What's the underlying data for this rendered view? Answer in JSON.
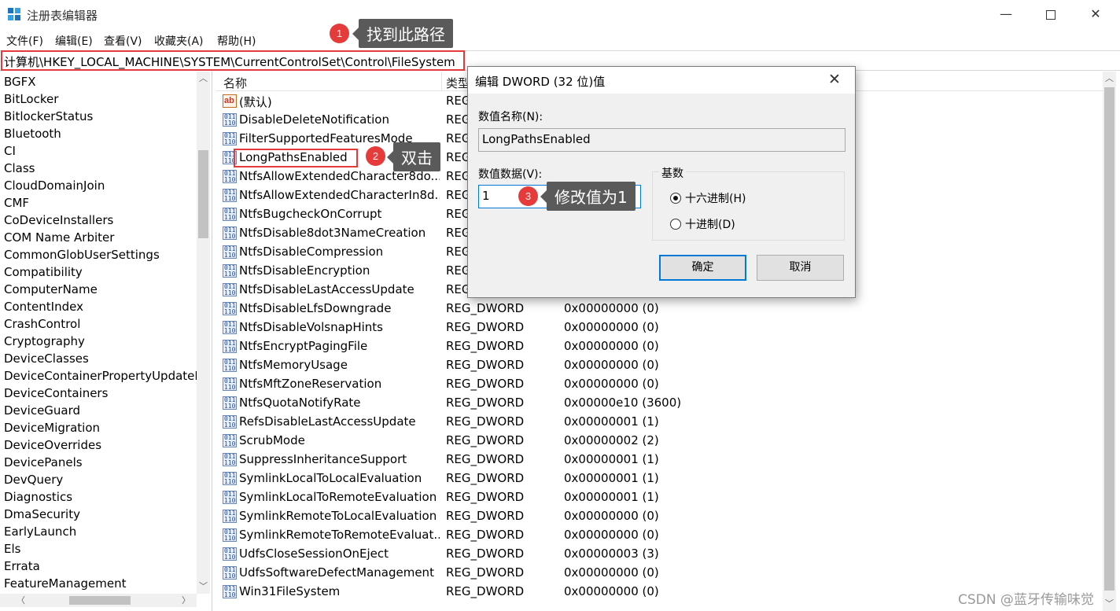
{
  "window": {
    "title": "注册表编辑器",
    "minimize_glyph": "—",
    "close_glyph": "✕"
  },
  "menu": [
    "文件(F)",
    "编辑(E)",
    "查看(V)",
    "收藏夹(A)",
    "帮助(H)"
  ],
  "address": "计算机\\HKEY_LOCAL_MACHINE\\SYSTEM\\CurrentControlSet\\Control\\FileSystem",
  "tree": {
    "items": [
      "BGFX",
      "BitLocker",
      "BitlockerStatus",
      "Bluetooth",
      "CI",
      "Class",
      "CloudDomainJoin",
      "CMF",
      "CoDeviceInstallers",
      "COM Name Arbiter",
      "CommonGlobUserSettings",
      "Compatibility",
      "ComputerName",
      "ContentIndex",
      "CrashControl",
      "Cryptography",
      "DeviceClasses",
      "DeviceContainerPropertyUpdateE",
      "DeviceContainers",
      "DeviceGuard",
      "DeviceMigration",
      "DeviceOverrides",
      "DevicePanels",
      "DevQuery",
      "Diagnostics",
      "DmaSecurity",
      "EarlyLaunch",
      "Els",
      "Errata",
      "FeatureManagement"
    ],
    "scroll_up": "︿",
    "scroll_down": "﹀",
    "scroll_left": "〈",
    "scroll_right": "〉"
  },
  "list": {
    "columns": {
      "name": "名称",
      "type": "类型"
    },
    "rows": [
      {
        "icon": "ab",
        "name": "(默认)",
        "type": "REG",
        "data": ""
      },
      {
        "icon": "bin",
        "name": "DisableDeleteNotification",
        "type": "REG",
        "data": ""
      },
      {
        "icon": "bin",
        "name": "FilterSupportedFeaturesMode",
        "type": "REG",
        "data": ""
      },
      {
        "icon": "bin",
        "name": "LongPathsEnabled",
        "type": "REG",
        "data": ""
      },
      {
        "icon": "bin",
        "name": "NtfsAllowExtendedCharacter8do...",
        "type": "REG",
        "data": ""
      },
      {
        "icon": "bin",
        "name": "NtfsAllowExtendedCharacterIn8d...",
        "type": "REG",
        "data": ""
      },
      {
        "icon": "bin",
        "name": "NtfsBugcheckOnCorrupt",
        "type": "REG",
        "data": ""
      },
      {
        "icon": "bin",
        "name": "NtfsDisable8dot3NameCreation",
        "type": "REG",
        "data": ""
      },
      {
        "icon": "bin",
        "name": "NtfsDisableCompression",
        "type": "REG",
        "data": ""
      },
      {
        "icon": "bin",
        "name": "NtfsDisableEncryption",
        "type": "REG",
        "data": ""
      },
      {
        "icon": "bin",
        "name": "NtfsDisableLastAccessUpdate",
        "type": "REG",
        "data": ""
      },
      {
        "icon": "bin",
        "name": "NtfsDisableLfsDowngrade",
        "type": "REG_DWORD",
        "data": "0x00000000 (0)"
      },
      {
        "icon": "bin",
        "name": "NtfsDisableVolsnapHints",
        "type": "REG_DWORD",
        "data": "0x00000000 (0)"
      },
      {
        "icon": "bin",
        "name": "NtfsEncryptPagingFile",
        "type": "REG_DWORD",
        "data": "0x00000000 (0)"
      },
      {
        "icon": "bin",
        "name": "NtfsMemoryUsage",
        "type": "REG_DWORD",
        "data": "0x00000000 (0)"
      },
      {
        "icon": "bin",
        "name": "NtfsMftZoneReservation",
        "type": "REG_DWORD",
        "data": "0x00000000 (0)"
      },
      {
        "icon": "bin",
        "name": "NtfsQuotaNotifyRate",
        "type": "REG_DWORD",
        "data": "0x00000e10 (3600)"
      },
      {
        "icon": "bin",
        "name": "RefsDisableLastAccessUpdate",
        "type": "REG_DWORD",
        "data": "0x00000001 (1)"
      },
      {
        "icon": "bin",
        "name": "ScrubMode",
        "type": "REG_DWORD",
        "data": "0x00000002 (2)"
      },
      {
        "icon": "bin",
        "name": "SuppressInheritanceSupport",
        "type": "REG_DWORD",
        "data": "0x00000001 (1)"
      },
      {
        "icon": "bin",
        "name": "SymlinkLocalToLocalEvaluation",
        "type": "REG_DWORD",
        "data": "0x00000001 (1)"
      },
      {
        "icon": "bin",
        "name": "SymlinkLocalToRemoteEvaluation",
        "type": "REG_DWORD",
        "data": "0x00000001 (1)"
      },
      {
        "icon": "bin",
        "name": "SymlinkRemoteToLocalEvaluation",
        "type": "REG_DWORD",
        "data": "0x00000000 (0)"
      },
      {
        "icon": "bin",
        "name": "SymlinkRemoteToRemoteEvaluat...",
        "type": "REG_DWORD",
        "data": "0x00000000 (0)"
      },
      {
        "icon": "bin",
        "name": "UdfsCloseSessionOnEject",
        "type": "REG_DWORD",
        "data": "0x00000003 (3)"
      },
      {
        "icon": "bin",
        "name": "UdfsSoftwareDefectManagement",
        "type": "REG_DWORD",
        "data": "0x00000000 (0)"
      },
      {
        "icon": "bin",
        "name": "Win31FileSystem",
        "type": "REG_DWORD",
        "data": "0x00000000 (0)"
      }
    ]
  },
  "dialog": {
    "title": "编辑 DWORD (32 位)值",
    "close_glyph": "✕",
    "name_label": "数值名称(N):",
    "name_value": "LongPathsEnabled",
    "data_label": "数值数据(V):",
    "data_value": "1",
    "base_label": "基数",
    "hex_label": "十六进制(H)",
    "dec_label": "十进制(D)",
    "selected_base": "hex",
    "ok_label": "确定",
    "cancel_label": "取消"
  },
  "callouts": [
    {
      "number": "1",
      "text": "找到此路径"
    },
    {
      "number": "2",
      "text": "双击"
    },
    {
      "number": "3",
      "text": "修改值为1"
    }
  ],
  "colors": {
    "callout_badge": "#e63b3b",
    "callout_tip": "#5a5a5a",
    "highlight_border": "#e43a3a",
    "focus_blue": "#0078d7"
  },
  "watermark": "CSDN @蓝牙传输味觉"
}
